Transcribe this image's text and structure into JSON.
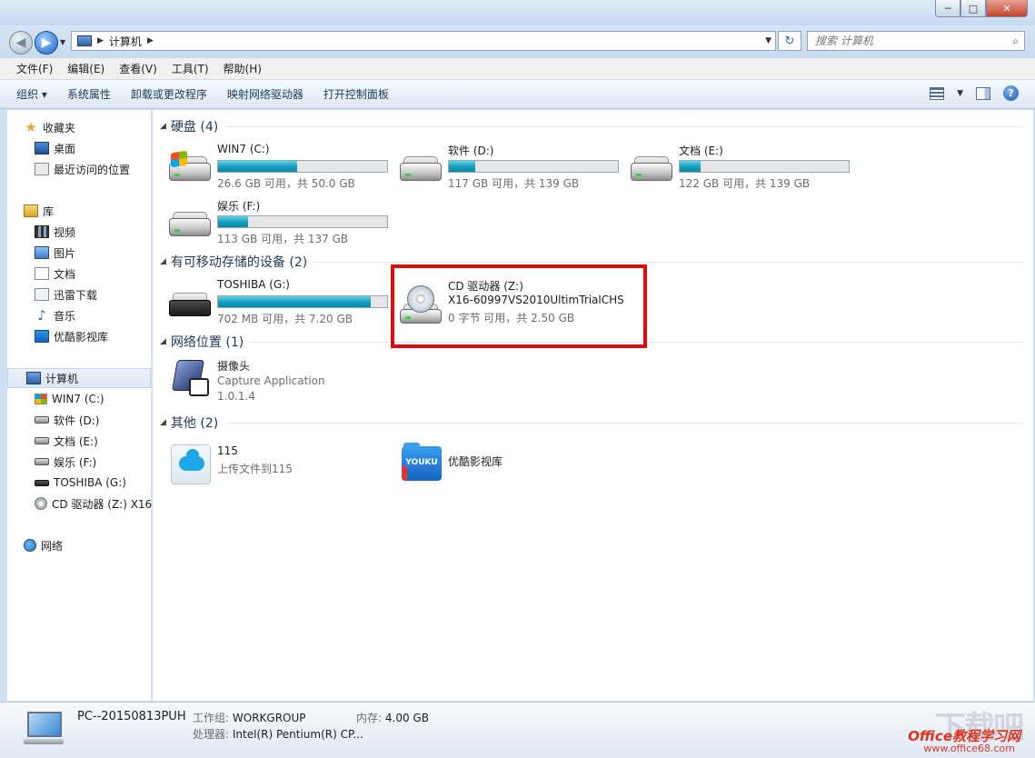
{
  "window": {
    "minimize": "─",
    "maximize": "□",
    "close": "✕"
  },
  "address": {
    "crumb": "计算机",
    "refresh": "↻",
    "search_placeholder": "搜索 计算机"
  },
  "menu": [
    "文件(F)",
    "编辑(E)",
    "查看(V)",
    "工具(T)",
    "帮助(H)"
  ],
  "commands": [
    "组织 ▾",
    "系统属性",
    "卸载或更改程序",
    "映射网络驱动器",
    "打开控制面板"
  ],
  "nav": {
    "favorites": "收藏夹",
    "desktop": "桌面",
    "recent": "最近访问的位置",
    "libraries": "库",
    "videos": "视频",
    "pictures": "图片",
    "documents": "文档",
    "xunlei": "迅雷下载",
    "music": "音乐",
    "youku_lib": "优酷影视库",
    "computer": "计算机",
    "drive_c": "WIN7 (C:)",
    "drive_d": "软件 (D:)",
    "drive_e": "文档 (E:)",
    "drive_f": "娱乐 (F:)",
    "drive_g": "TOSHIBA (G:)",
    "drive_z": "CD 驱动器 (Z:) X16",
    "network": "网络"
  },
  "groups": {
    "hdd": "硬盘 (4)",
    "removable": "有可移动存储的设备 (2)",
    "netloc": "网络位置 (1)",
    "other": "其他 (2)"
  },
  "drives": {
    "c": {
      "name": "WIN7 (C:)",
      "status": "26.6 GB 可用，共 50.0 GB",
      "used_fraction": 0.468
    },
    "d": {
      "name": "软件 (D:)",
      "status": "117 GB 可用，共 139 GB",
      "used_fraction": 0.158
    },
    "e": {
      "name": "文档 (E:)",
      "status": "122 GB 可用，共 139 GB",
      "used_fraction": 0.122
    },
    "f": {
      "name": "娱乐 (F:)",
      "status": "113 GB 可用，共 137 GB",
      "used_fraction": 0.175
    },
    "g": {
      "name": "TOSHIBA (G:)",
      "status": "702 MB 可用，共 7.20 GB",
      "used_fraction": 0.905
    },
    "z": {
      "name": "CD 驱动器 (Z:)",
      "label": "X16-60997VS2010UltimTrialCHS",
      "status": "0 字节 可用，共 2.50 GB"
    }
  },
  "netloc": {
    "name": "摄像头",
    "app": "Capture Application",
    "version": "1.0.1.4"
  },
  "other": {
    "cloud": {
      "name": "115",
      "desc": "上传文件到115"
    },
    "youku": {
      "name": "优酷影视库",
      "icon_text": "YOUKU"
    }
  },
  "details": {
    "pc_name": "PC--20150813PUH",
    "workgroup_label": "工作组:",
    "workgroup": "WORKGROUP",
    "memory_label": "内存:",
    "memory": "4.00 GB",
    "cpu_label": "处理器:",
    "cpu": "Intel(R) Pentium(R) CP..."
  },
  "watermark": {
    "big": "下载吧",
    "line1": "Office教程学习网",
    "line2": "www.office68.com"
  },
  "colors": {
    "accent": "#1e395b",
    "bar_fill": "#1aa0c0",
    "highlight": "#e00b0b"
  }
}
